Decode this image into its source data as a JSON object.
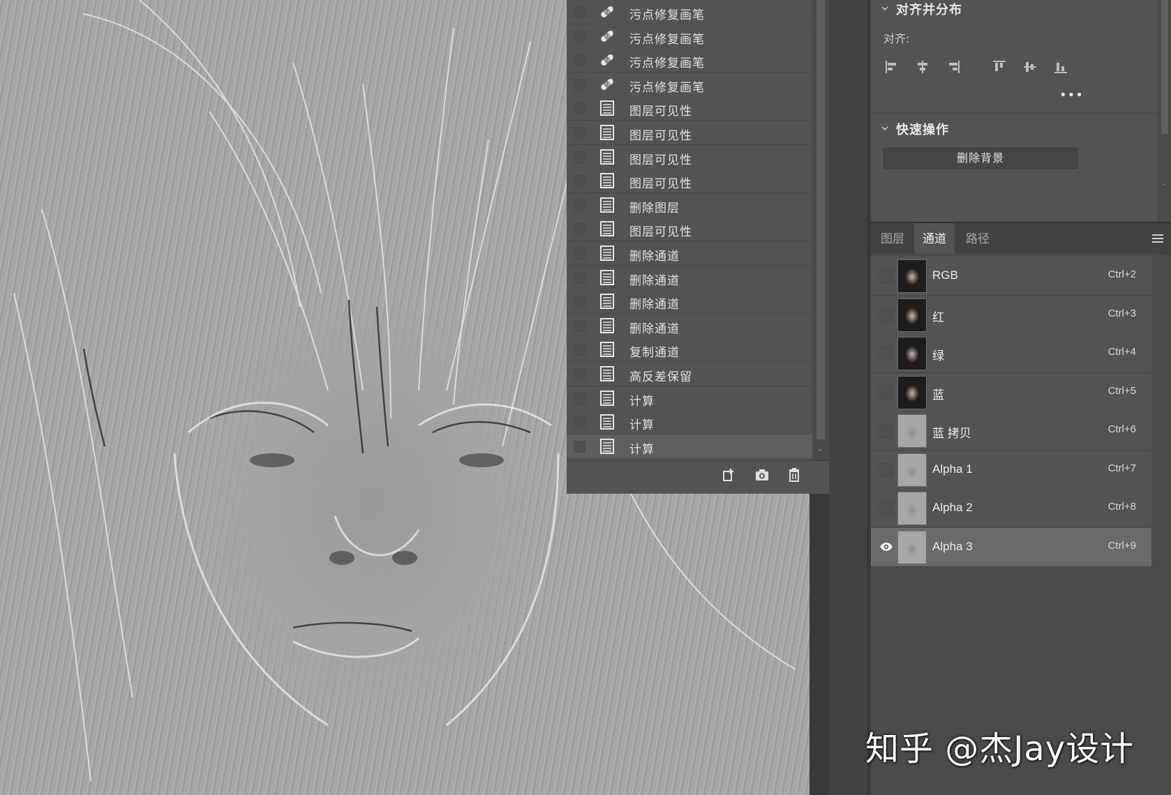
{
  "history": {
    "items": [
      {
        "label": "污点修复画笔",
        "icon": "spot-healing-brush-icon"
      },
      {
        "label": "污点修复画笔",
        "icon": "spot-healing-brush-icon"
      },
      {
        "label": "污点修复画笔",
        "icon": "spot-healing-brush-icon"
      },
      {
        "label": "污点修复画笔",
        "icon": "spot-healing-brush-icon"
      },
      {
        "label": "图层可见性",
        "icon": "history-state-icon"
      },
      {
        "label": "图层可见性",
        "icon": "history-state-icon"
      },
      {
        "label": "图层可见性",
        "icon": "history-state-icon"
      },
      {
        "label": "图层可见性",
        "icon": "history-state-icon"
      },
      {
        "label": "删除图层",
        "icon": "history-state-icon"
      },
      {
        "label": "图层可见性",
        "icon": "history-state-icon"
      },
      {
        "label": "删除通道",
        "icon": "history-state-icon"
      },
      {
        "label": "删除通道",
        "icon": "history-state-icon"
      },
      {
        "label": "删除通道",
        "icon": "history-state-icon"
      },
      {
        "label": "删除通道",
        "icon": "history-state-icon"
      },
      {
        "label": "复制通道",
        "icon": "history-state-icon"
      },
      {
        "label": "高反差保留",
        "icon": "history-state-icon"
      },
      {
        "label": "计算",
        "icon": "history-state-icon"
      },
      {
        "label": "计算",
        "icon": "history-state-icon"
      },
      {
        "label": "计算",
        "icon": "history-state-icon",
        "selected": true
      }
    ],
    "footer_icons": [
      "new-document-from-state-icon",
      "camera-snapshot-icon",
      "trash-icon"
    ]
  },
  "properties": {
    "align_section_title": "对齐并分布",
    "align_label": "对齐:",
    "align_icons": [
      "align-left-icon",
      "align-horizontal-center-icon",
      "align-right-icon",
      "align-top-icon",
      "align-vertical-center-icon",
      "align-bottom-icon"
    ],
    "more": "•••",
    "quick_actions_title": "快速操作",
    "remove_background_button": "删除背景"
  },
  "tabs": [
    {
      "label": "图层",
      "active": false
    },
    {
      "label": "通道",
      "active": true
    },
    {
      "label": "路径",
      "active": false
    }
  ],
  "channels": [
    {
      "name": "RGB",
      "shortcut": "Ctrl+2",
      "thumb": "color"
    },
    {
      "name": "红",
      "shortcut": "Ctrl+3",
      "thumb": "color"
    },
    {
      "name": "绿",
      "shortcut": "Ctrl+4",
      "thumb": "color"
    },
    {
      "name": "蓝",
      "shortcut": "Ctrl+5",
      "thumb": "color"
    },
    {
      "name": "蓝 拷贝",
      "shortcut": "Ctrl+6",
      "thumb": "gray"
    },
    {
      "name": "Alpha 1",
      "shortcut": "Ctrl+7",
      "thumb": "gray"
    },
    {
      "name": "Alpha 2",
      "shortcut": "Ctrl+8",
      "thumb": "gray"
    },
    {
      "name": "Alpha 3",
      "shortcut": "Ctrl+9",
      "thumb": "gray",
      "visible": true,
      "selected": true
    }
  ],
  "watermark": "知乎 @杰Jay设计",
  "colors": {
    "panel_bg": "#535353",
    "selected_row": "#6a6a6a",
    "canvas_gray": "#a6a6a6"
  }
}
